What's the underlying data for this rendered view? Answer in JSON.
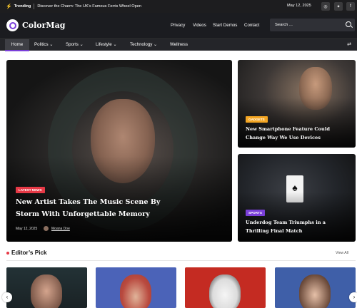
{
  "topbar": {
    "trending_label": "Trending",
    "trending_text": "Discover the Charm: The UK’s Famous Ferris Wheel Open",
    "date": "May 12, 2025",
    "social_icons": [
      "instagram-icon",
      "twitter-icon",
      "facebook-icon"
    ]
  },
  "header": {
    "brand": "ColorMag",
    "nav": [
      "Privacy",
      "Videos",
      "Start Demos",
      "Contact"
    ],
    "search_placeholder": "Search ..."
  },
  "mainnav": {
    "items": [
      {
        "label": "Home",
        "active": true
      },
      {
        "label": "Politics",
        "dropdown": true
      },
      {
        "label": "Sports",
        "dropdown": true
      },
      {
        "label": "Lifestyle",
        "dropdown": true
      },
      {
        "label": "Technology",
        "dropdown": true
      },
      {
        "label": "Wellness",
        "dropdown": false
      }
    ]
  },
  "featured": {
    "badge": "LATEST NEWS",
    "badge_color": "#e63946",
    "title": "New Artist Takes The Music Scene By Storm With Unforgettable Memory",
    "date": "May 12, 2025",
    "author": "Moana Doe"
  },
  "side_cards": [
    {
      "badge": "GADGETS",
      "badge_color": "#f4a623",
      "title": "New Smartphone Feature Could Change Way We Use Devices"
    },
    {
      "badge": "SPORTS",
      "badge_color": "#7a3fd9",
      "title": "Underdog Team Triumphs in a Thrilling Final Match"
    }
  ],
  "editors_pick": {
    "title": "Editor’s Pick",
    "view_all": "View All",
    "accent": "#e63946",
    "prev_arrow": "‹",
    "next_arrow": "›"
  },
  "colors": {
    "purple_accent": "#7a3fd9",
    "dark_header": "#1b1c20"
  }
}
